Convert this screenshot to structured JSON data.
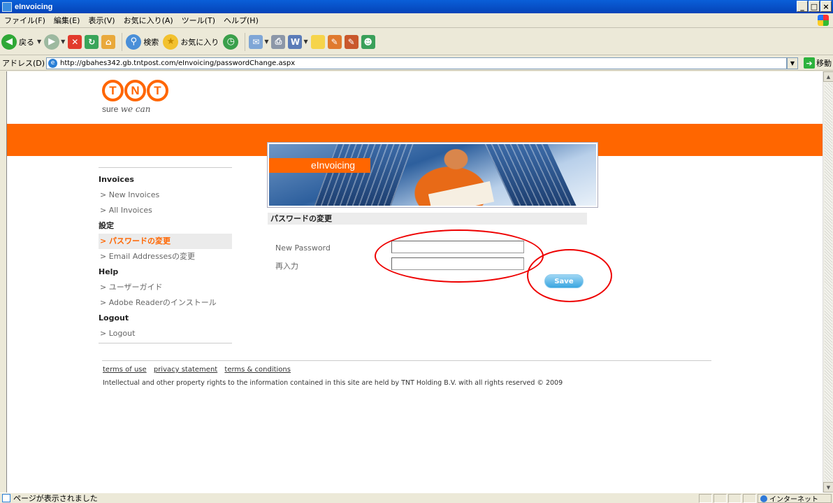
{
  "window": {
    "title": "eInvoicing",
    "buttons": [
      "_",
      "□",
      "×"
    ]
  },
  "menu": [
    "ファイル(F)",
    "編集(E)",
    "表示(V)",
    "お気に入り(A)",
    "ツール(T)",
    "ヘルプ(H)"
  ],
  "toolbar": {
    "back_label": "戻る",
    "search_label": "検索",
    "favorites_label": "お気に入り"
  },
  "address": {
    "label": "アドレス(D)",
    "url": "http://gbahes342.gb.tntpost.com/eInvoicing/passwordChange.aspx",
    "go_label": "移動"
  },
  "logo": {
    "letters": [
      "T",
      "N",
      "T"
    ],
    "tagline_plain": "sure ",
    "tagline_script": "we can"
  },
  "hero": {
    "label": "eInvoicing"
  },
  "sidebar": {
    "sections": [
      {
        "heading": "Invoices",
        "links": [
          {
            "label": "> New Invoices"
          },
          {
            "label": "> All Invoices"
          }
        ]
      },
      {
        "heading": "設定",
        "links": [
          {
            "label": "> パスワードの変更",
            "active": true
          },
          {
            "label": "> Email Addressesの変更"
          }
        ]
      },
      {
        "heading": "Help",
        "links": [
          {
            "label": "> ユーザーガイド"
          },
          {
            "label": "> Adobe Readerのインストール"
          }
        ]
      },
      {
        "heading": "Logout",
        "links": [
          {
            "label": "> Logout"
          }
        ]
      }
    ]
  },
  "form": {
    "title": "パスワードの変更",
    "new_password_label": "New Password",
    "new_password_value": "",
    "confirm_label": "再入力",
    "confirm_value": "",
    "save_label": "Save"
  },
  "footer": {
    "links": [
      "terms of use",
      "privacy statement",
      "terms & conditions"
    ],
    "copyright": "Intellectual and other property rights to the information contained in this site are held by TNT Holding B.V. with all rights reserved © 2009"
  },
  "status": {
    "text": "ページが表示されました",
    "zone": "インターネット"
  },
  "colors": {
    "brand_orange": "#ff6600",
    "annotation_red": "#e00000",
    "save_blue": "#3aa6e0"
  }
}
